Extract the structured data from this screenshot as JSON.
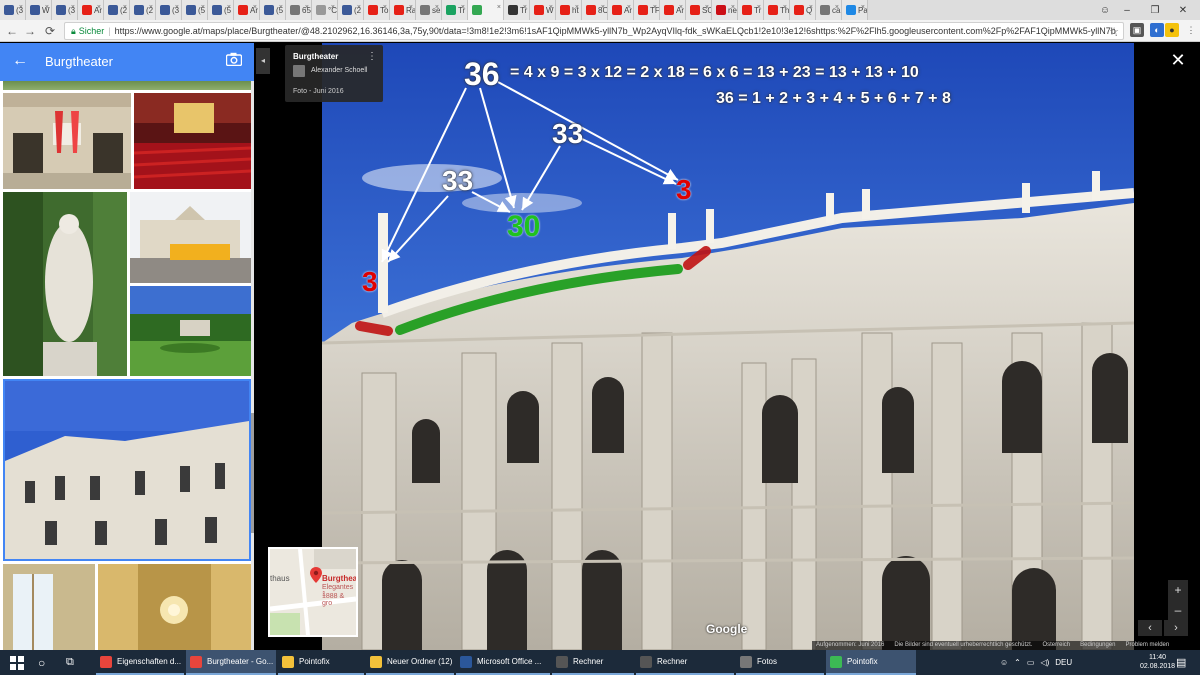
{
  "browser": {
    "tabs": [
      {
        "icon": "facebook-icon",
        "label": "(3",
        "color": "#3b5998"
      },
      {
        "icon": "facebook-icon",
        "label": "W",
        "color": "#3b5998"
      },
      {
        "icon": "facebook-icon",
        "label": "(3",
        "color": "#3b5998"
      },
      {
        "icon": "youtube-icon",
        "label": "Ar",
        "color": "#e62117"
      },
      {
        "icon": "facebook-icon",
        "label": "(2",
        "color": "#3b5998"
      },
      {
        "icon": "facebook-icon",
        "label": "(2",
        "color": "#3b5998"
      },
      {
        "icon": "facebook-icon",
        "label": "(3",
        "color": "#3b5998"
      },
      {
        "icon": "facebook-icon",
        "label": "(5",
        "color": "#3b5998"
      },
      {
        "icon": "facebook-icon",
        "label": "(5",
        "color": "#3b5998"
      },
      {
        "icon": "youtube-icon",
        "label": "Ar",
        "color": "#e62117"
      },
      {
        "icon": "facebook-icon",
        "label": "(5",
        "color": "#3b5998"
      },
      {
        "icon": "google-icon",
        "label": "65",
        "color": "#777777"
      },
      {
        "icon": "page-icon",
        "label": "°C",
        "color": "#999999"
      },
      {
        "icon": "facebook-icon",
        "label": "(2",
        "color": "#3b5998"
      },
      {
        "icon": "youtube-icon",
        "label": "To",
        "color": "#e62117"
      },
      {
        "icon": "youtube-icon",
        "label": "Ra",
        "color": "#e62117"
      },
      {
        "icon": "google-icon",
        "label": "se",
        "color": "#777777"
      },
      {
        "icon": "app-icon",
        "label": "Tr",
        "color": "#1aa260"
      },
      {
        "icon": "maps-icon",
        "label": "",
        "color": "#34a853",
        "active": true
      },
      {
        "icon": "app-icon",
        "label": "Tr",
        "color": "#333333"
      },
      {
        "icon": "youtube-icon",
        "label": "W",
        "color": "#e62117"
      },
      {
        "icon": "youtube-icon",
        "label": "ht",
        "color": "#e62117"
      },
      {
        "icon": "youtube-icon",
        "label": "8C",
        "color": "#e62117"
      },
      {
        "icon": "youtube-icon",
        "label": "Ar",
        "color": "#e62117"
      },
      {
        "icon": "youtube-icon",
        "label": "TF",
        "color": "#e62117"
      },
      {
        "icon": "youtube-icon",
        "label": "Ar",
        "color": "#e62117"
      },
      {
        "icon": "youtube-icon",
        "label": "SC",
        "color": "#e62117"
      },
      {
        "icon": "opera-icon",
        "label": "ne",
        "color": "#cc0f16"
      },
      {
        "icon": "youtube-icon",
        "label": "Tr",
        "color": "#e62117"
      },
      {
        "icon": "youtube-icon",
        "label": "Th",
        "color": "#e62117"
      },
      {
        "icon": "youtube-icon",
        "label": "Q",
        "color": "#e62117"
      },
      {
        "icon": "google-icon",
        "label": "ca",
        "color": "#777777"
      },
      {
        "icon": "app-icon",
        "label": "Pa",
        "color": "#1e88e5"
      }
    ],
    "address": {
      "secure_label": "Sicher",
      "url": "https://www.google.at/maps/place/Burgtheater/@48.2102962,16.36146,3a,75y,90t/data=!3m8!1e2!3m6!1sAF1QipMMWk5-yllN7b_Wp2AyqVIlq-fdk_sWKaELQcb1!2e10!3e12!6shttps:%2F%2Flh5.googleusercontent.com%2Fp%2FAF1QipMMWk5-yllN7b_..."
    }
  },
  "panel": {
    "title": "Burgtheater",
    "accent": "#4285f4"
  },
  "infocard": {
    "title": "Burgtheater",
    "author": "Alexander Schoell",
    "date": "Foto - Juni 2016"
  },
  "annotations": {
    "big_number": "36",
    "equation1": "= 4 x 9 = 3 x 12 = 2 x 18 = 6 x 6 = 13 + 23 = 13 + 13 + 10",
    "equation2": "36 = 1 + 2 + 3 + 4 + 5 + 6 + 7 + 8",
    "label_33_left": "33",
    "label_33_right": "33",
    "label_30": "30",
    "label_3_left": "3",
    "label_3_right": "3",
    "colors": {
      "red": "#e00000",
      "green": "#1fc21f"
    }
  },
  "minimap": {
    "left_text": "thaus",
    "title": "Burgtheat",
    "sub1": "Elegantes 1",
    "sub2": "1888 & gro"
  },
  "viewer": {
    "logo": "Google",
    "footer": [
      "Aufgenommen: Juni 2016",
      "Die Bilder sind eventuell urheberrechtlich geschützt.",
      "Österreich",
      "Bedingungen",
      "Problem melden"
    ]
  },
  "taskbar": {
    "items": [
      {
        "label": "Eigenschaften d...",
        "icon": "chrome-icon",
        "color": "#e8453c"
      },
      {
        "label": "Burgtheater - Go...",
        "icon": "chrome-icon",
        "color": "#e8453c",
        "active": true
      },
      {
        "label": "Pointofix",
        "icon": "folder-icon",
        "color": "#f3c13a"
      },
      {
        "label": "Neuer Ordner (12)",
        "icon": "folder-icon",
        "color": "#f3c13a"
      },
      {
        "label": "Microsoft Office ...",
        "icon": "office-icon",
        "color": "#2b579a"
      },
      {
        "label": "Rechner",
        "icon": "calculator-icon",
        "color": "#555555"
      },
      {
        "label": "Rechner",
        "icon": "calculator-icon",
        "color": "#555555"
      },
      {
        "label": "Fotos",
        "icon": "photos-icon",
        "color": "#777777"
      },
      {
        "label": "Pointofix",
        "icon": "pointofix-icon",
        "color": "#3cba54",
        "active": true
      }
    ],
    "language": "DEU",
    "time": "11:40",
    "date": "02.08.2018"
  }
}
